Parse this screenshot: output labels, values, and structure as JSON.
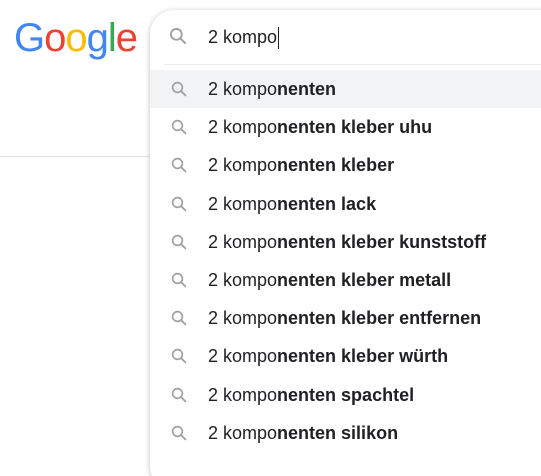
{
  "logo": {
    "letters": [
      "G",
      "o",
      "o",
      "g",
      "l",
      "e"
    ],
    "colors": [
      "#4285F4",
      "#EA4335",
      "#FBBC05",
      "#4285F4",
      "#34A853",
      "#EA4335"
    ]
  },
  "search": {
    "query": "2 kompo",
    "icon": "search-icon"
  },
  "suggestions": [
    {
      "typed": "2 kompo",
      "completion": "nenten"
    },
    {
      "typed": "2 kompo",
      "completion": "nenten kleber uhu"
    },
    {
      "typed": "2 kompo",
      "completion": "nenten kleber"
    },
    {
      "typed": "2 kompo",
      "completion": "nenten lack"
    },
    {
      "typed": "2 kompo",
      "completion": "nenten kleber kunststoff"
    },
    {
      "typed": "2 kompo",
      "completion": "nenten kleber metall"
    },
    {
      "typed": "2 kompo",
      "completion": "nenten kleber entfernen"
    },
    {
      "typed": "2 kompo",
      "completion": "nenten kleber würth"
    },
    {
      "typed": "2 kompo",
      "completion": "nenten spachtel"
    },
    {
      "typed": "2 kompo",
      "completion": "nenten silikon"
    }
  ],
  "colors": {
    "text": "#202124",
    "icon": "#9aa0a6",
    "highlight": "#f1f3f4"
  }
}
